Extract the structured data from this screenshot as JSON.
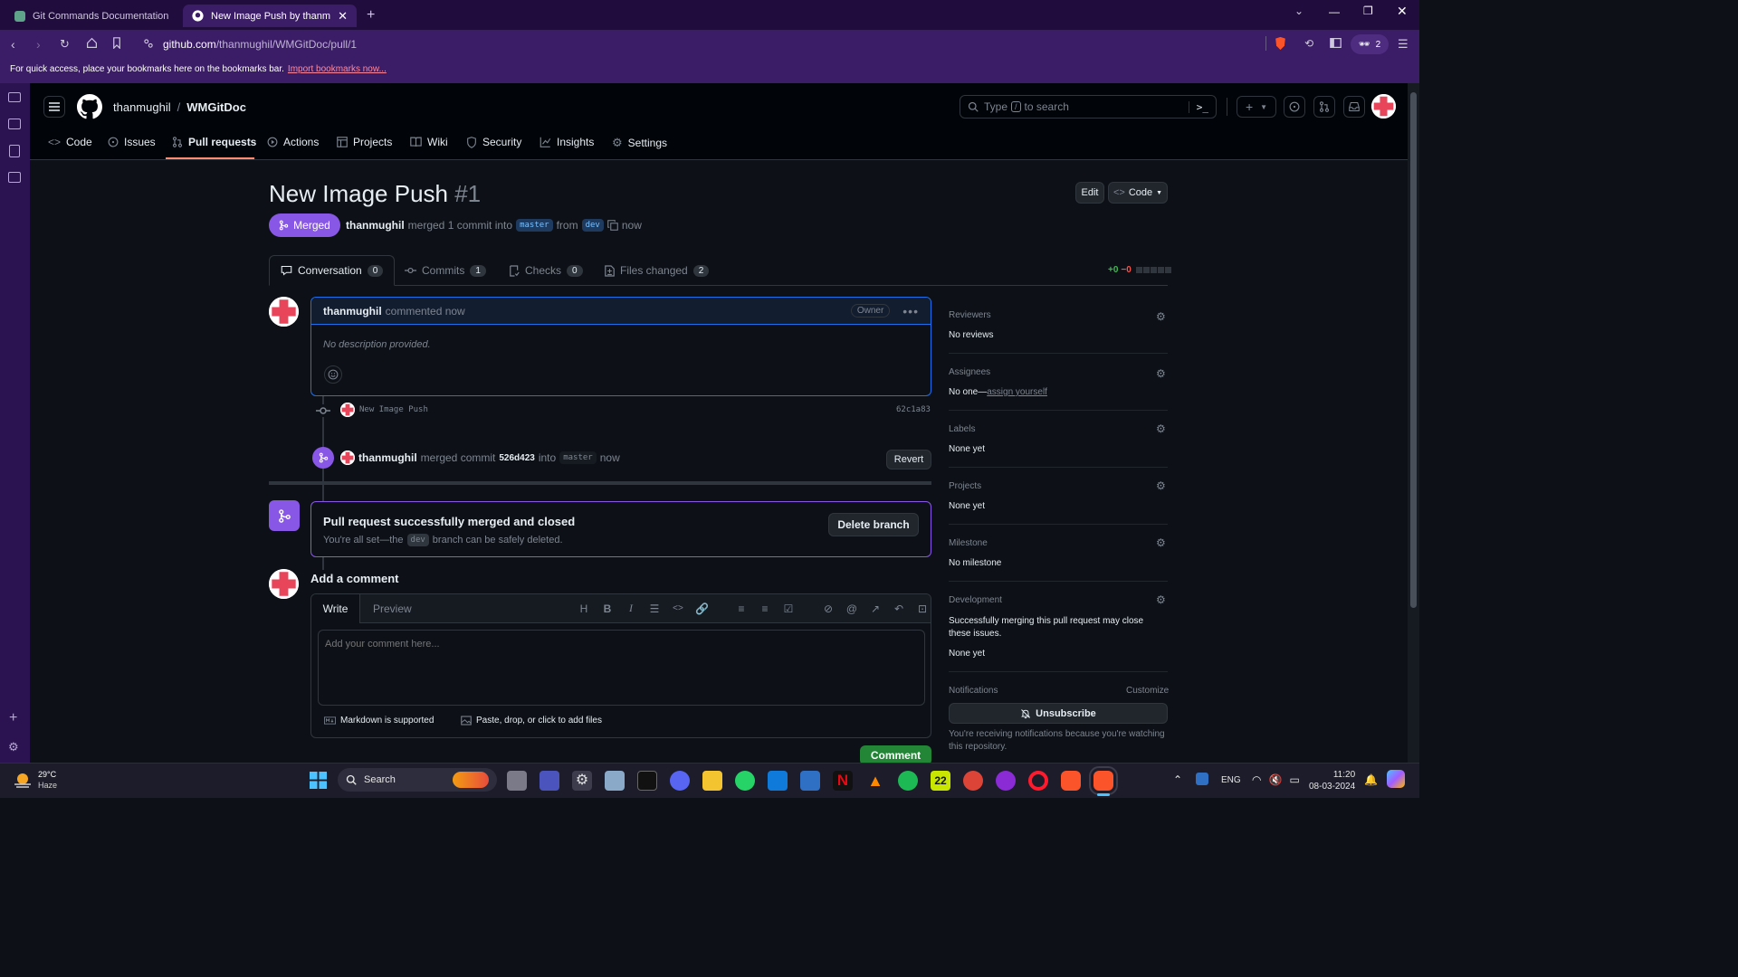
{
  "browser": {
    "tabs": [
      {
        "title": "Git Commands Documentation",
        "active": false
      },
      {
        "title": "New Image Push by thanmughi",
        "active": true
      }
    ],
    "url": "github.com/thanmughil/WMGitDoc/pull/1",
    "url_host": "github.com",
    "url_path": "/thanmughil/WMGitDoc/pull/1",
    "brave_count": "2",
    "bookmarks_hint": "For quick access, place your bookmarks here on the bookmarks bar.",
    "bookmarks_link": "Import bookmarks now..."
  },
  "repo": {
    "owner": "thanmughil",
    "separator": "/",
    "name": "WMGitDoc",
    "search_placeholder_pre": "Type",
    "search_key": "/",
    "search_placeholder_post": "to search",
    "nav": [
      {
        "label": "Code",
        "icon": "code-icon"
      },
      {
        "label": "Issues",
        "icon": "issue-icon"
      },
      {
        "label": "Pull requests",
        "icon": "pull-request-icon",
        "active": true
      },
      {
        "label": "Actions",
        "icon": "play-icon"
      },
      {
        "label": "Projects",
        "icon": "table-icon"
      },
      {
        "label": "Wiki",
        "icon": "book-icon"
      },
      {
        "label": "Security",
        "icon": "shield-icon"
      },
      {
        "label": "Insights",
        "icon": "graph-icon"
      },
      {
        "label": "Settings",
        "icon": "gear-icon"
      }
    ]
  },
  "pr": {
    "title": "New Image Push",
    "number": "#1",
    "edit_label": "Edit",
    "code_label": "Code",
    "status": "Merged",
    "author": "thanmughil",
    "merge_text": "merged 1 commit into",
    "base_branch": "master",
    "from_text": "from",
    "head_branch": "dev",
    "time": "now",
    "tabs": [
      {
        "label": "Conversation",
        "count": "0"
      },
      {
        "label": "Commits",
        "count": "1"
      },
      {
        "label": "Checks",
        "count": "0"
      },
      {
        "label": "Files changed",
        "count": "2"
      }
    ],
    "diff_add": "+0",
    "diff_del": "−0"
  },
  "comment": {
    "author": "thanmughil",
    "action": "commented now",
    "badge": "Owner",
    "body": "No description provided."
  },
  "commit": {
    "message": "New Image Push",
    "sha": "62c1a83"
  },
  "merge_event": {
    "author": "thanmughil",
    "text1": "merged commit",
    "sha": "526d423",
    "text2": "into",
    "branch": "master",
    "time": "now",
    "revert_label": "Revert"
  },
  "merged_box": {
    "title": "Pull request successfully merged and closed",
    "sub_pre": "You're all set—the",
    "branch": "dev",
    "sub_post": "branch can be safely deleted.",
    "delete_label": "Delete branch"
  },
  "add_comment": {
    "heading": "Add a comment",
    "tab_write": "Write",
    "tab_preview": "Preview",
    "placeholder": "Add your comment here...",
    "markdown_note": "Markdown is supported",
    "files_note": "Paste, drop, or click to add files",
    "submit_label": "Comment"
  },
  "sidebar": {
    "reviewers_title": "Reviewers",
    "reviewers_value": "No reviews",
    "assignees_title": "Assignees",
    "assignees_value": "No one—",
    "assignees_link": "assign yourself",
    "labels_title": "Labels",
    "labels_value": "None yet",
    "projects_title": "Projects",
    "projects_value": "None yet",
    "milestone_title": "Milestone",
    "milestone_value": "No milestone",
    "development_title": "Development",
    "development_note": "Successfully merging this pull request may close these issues.",
    "development_value": "None yet",
    "notifications_title": "Notifications",
    "customize_label": "Customize",
    "unsubscribe_label": "Unsubscribe",
    "notifications_note": "You're receiving notifications because you're watching this repository."
  },
  "taskbar": {
    "weather_temp": "29°C",
    "weather_desc": "Haze",
    "search_label": "Search",
    "lang": "ENG",
    "time": "11:20",
    "date": "08-03-2024"
  },
  "colors": {
    "merged": "#8957e5",
    "accent_blue": "#1f6feb",
    "comment_green": "#238636",
    "brave_purple": "#3b1c66"
  }
}
